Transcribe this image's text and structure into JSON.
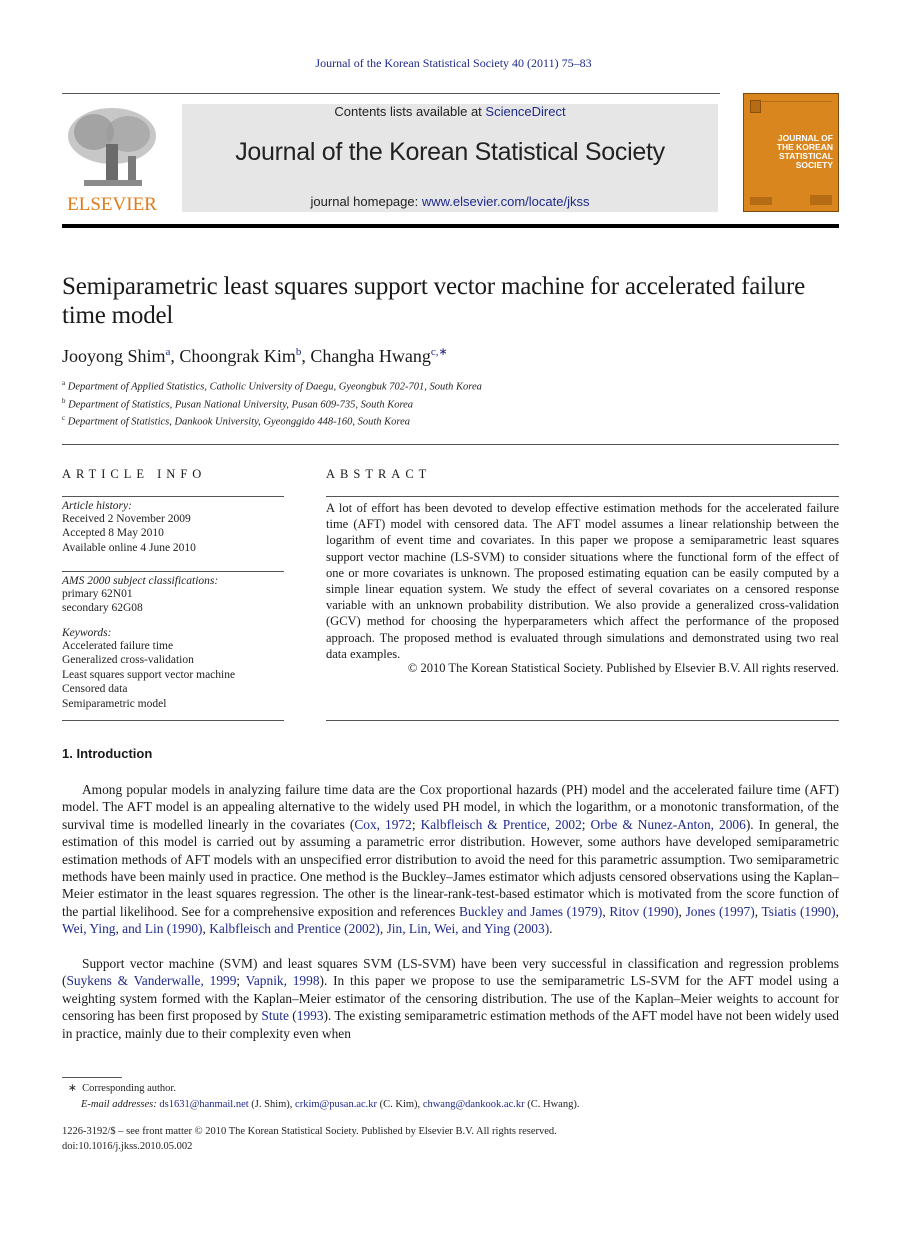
{
  "running_head": "Journal of the Korean Statistical Society 40 (2011) 75–83",
  "masthead": {
    "publisher_logo_text": "ELSEVIER",
    "contents_prefix": "Contents lists available at ",
    "contents_link": "ScienceDirect",
    "journal_name": "Journal of the Korean Statistical Society",
    "homepage_prefix": "journal homepage: ",
    "homepage_link": "www.elsevier.com/locate/jkss",
    "cover_lines": [
      "JOURNAL OF",
      "THE KOREAN",
      "STATISTICAL",
      "SOCIETY"
    ],
    "colors": {
      "logo_orange": "#e07b1a",
      "cover": "#d9861f",
      "link": "#1f2a8a"
    }
  },
  "article": {
    "title": "Semiparametric least squares support vector machine for accelerated failure time model",
    "authors": [
      {
        "name": "Jooyong Shim",
        "sup": "a"
      },
      {
        "name": "Choongrak Kim",
        "sup": "b"
      },
      {
        "name": "Changha Hwang",
        "sup": "c,∗"
      }
    ],
    "affiliations": [
      {
        "mark": "a",
        "text": "Department of Applied Statistics, Catholic University of Daegu, Gyeongbuk 702-701, South Korea"
      },
      {
        "mark": "b",
        "text": "Department of Statistics, Pusan National University, Pusan 609-735, South Korea"
      },
      {
        "mark": "c",
        "text": "Department of Statistics, Dankook University, Gyeonggido 448-160, South Korea"
      }
    ]
  },
  "article_info": {
    "heading": "ARTICLE INFO",
    "history_label": "Article history:",
    "history": [
      "Received 2 November 2009",
      "Accepted 8 May 2010",
      "Available online 4 June 2010"
    ],
    "ams_label": "AMS 2000 subject classifications:",
    "ams": [
      "primary 62N01",
      "secondary 62G08"
    ],
    "keywords_label": "Keywords:",
    "keywords": [
      "Accelerated failure time",
      "Generalized cross-validation",
      "Least squares support vector machine",
      "Censored data",
      "Semiparametric model"
    ]
  },
  "abstract": {
    "heading": "ABSTRACT",
    "text": "A lot of effort has been devoted to develop effective estimation methods for the accelerated failure time (AFT) model with censored data. The AFT model assumes a linear relationship between the logarithm of event time and covariates. In this paper we propose a semiparametric least squares support vector machine (LS-SVM) to consider situations where the functional form of the effect of one or more covariates is unknown. The proposed estimating equation can be easily computed by a simple linear equation system. We study the effect of several covariates on a censored response variable with an unknown probability distribution. We also provide a generalized cross-validation (GCV) method for choosing the hyperparameters which affect the performance of the proposed approach. The proposed method is evaluated through simulations and demonstrated using two real data examples.",
    "copyright": "© 2010 The Korean Statistical Society. Published by Elsevier B.V. All rights reserved."
  },
  "introduction": {
    "heading": "1.  Introduction",
    "p1": {
      "t1": "Among popular models in analyzing failure time data are the Cox proportional hazards (PH) model and the accelerated failure time (AFT) model. The AFT model is an appealing alternative to the widely used PH model, in which the logarithm, or a monotonic transformation, of the survival time is modelled linearly in the covariates (",
      "c1": "Cox, 1972",
      "s1": "; ",
      "c2": "Kalbfleisch & Prentice, 2002",
      "s2": "; ",
      "c3": "Orbe & Nunez-Anton, 2006",
      "t2": "). In general, the estimation of this model is carried out by assuming a parametric error distribution. However, some authors have developed semiparametric estimation methods of AFT models with an unspecified error distribution to avoid the need for this parametric assumption. Two semiparametric methods have been mainly used in practice. One method is the Buckley–James estimator which adjusts censored observations using the Kaplan–Meier estimator in the least squares regression. The other is the linear-rank-test-based estimator which is motivated from the score function of the partial likelihood. See for a comprehensive exposition and references ",
      "c4": "Buckley and James (1979)",
      "s4": ", ",
      "c5": "Ritov (1990)",
      "s5": ", ",
      "c6": "Jones (1997)",
      "s6": ", ",
      "c7": "Tsiatis (1990)",
      "s7": ", ",
      "c8": "Wei, Ying, and Lin (1990)",
      "s8": ", ",
      "c9": "Kalbfleisch and Prentice (2002)",
      "s9": ", ",
      "c10": "Jin, Lin, Wei, and Ying (2003)",
      "t3": "."
    },
    "p2": {
      "t1": "Support vector machine (SVM) and least squares SVM (LS-SVM) have been very successful in classification and regression problems (",
      "c1": "Suykens & Vanderwalle, 1999",
      "s1": "; ",
      "c2": "Vapnik, 1998",
      "t2": "). In this paper we propose to use the semiparametric LS-SVM for the AFT model using a weighting system formed with the Kaplan–Meier estimator of the censoring distribution. The use of the Kaplan–Meier weights to account for censoring has been first proposed by ",
      "c3": "Stute",
      "t3": " (",
      "c4": "1993",
      "t4": "). The existing semiparametric estimation methods of the AFT model have not been widely used in practice, mainly due to their complexity even when"
    }
  },
  "footnotes": {
    "corresponding_mark": "∗",
    "corresponding": "Corresponding author.",
    "email_label": "E-mail addresses:",
    "emails": [
      {
        "addr": "ds1631@hanmail.net",
        "who": " (J. Shim), "
      },
      {
        "addr": "crkim@pusan.ac.kr",
        "who": " (C. Kim), "
      },
      {
        "addr": "chwang@dankook.ac.kr",
        "who": " (C. Hwang)."
      }
    ],
    "issn_line": "1226-3192/$ – see front matter © 2010 The Korean Statistical Society. Published by Elsevier B.V. All rights reserved.",
    "doi": "doi:10.1016/j.jkss.2010.05.002"
  }
}
